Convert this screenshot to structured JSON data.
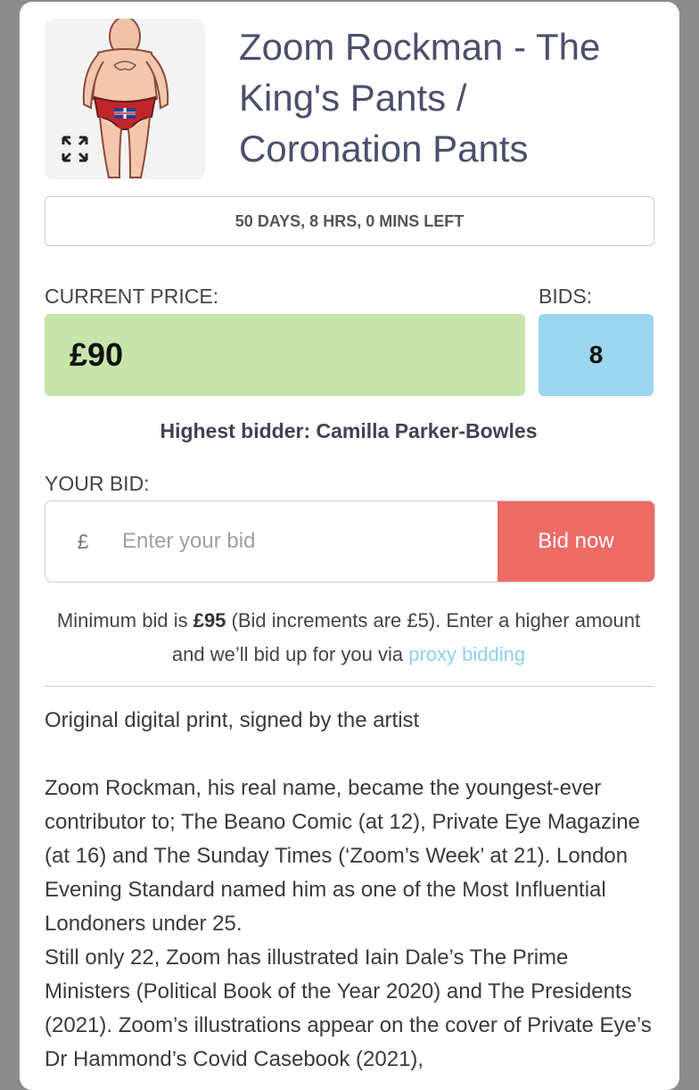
{
  "listing": {
    "title": "Zoom Rockman - The King's Pants / Coronation Pants",
    "time_left": "50 DAYS, 8 HRS, 0 MINS LEFT",
    "current_price_label": "CURRENT PRICE:",
    "current_price": "£90",
    "bids_label": "BIDS:",
    "bids_count": "8",
    "highest_bidder": "Highest bidder: Camilla Parker-Bowles"
  },
  "bid_form": {
    "label": "YOUR BID:",
    "currency_symbol": "£",
    "placeholder": "Enter your bid",
    "button_label": "Bid now",
    "min_prefix": "Minimum bid is ",
    "min_amount": "£95",
    "min_suffix": " (Bid increments are £5). Enter a higher amount and we’ll bid up for you via ",
    "proxy_link": "proxy bidding"
  },
  "description": {
    "line1": "Original digital print, signed by the artist",
    "para1": "Zoom Rockman, his real name, became the youngest-ever contributor to; The Beano Comic (at 12), Private Eye Magazine (at 16) and The Sunday Times (‘Zoom’s Week’ at 21). London Evening Standard named him as one of the Most Influential Londoners under 25.",
    "para2": "Still only 22, Zoom has illustrated Iain Dale’s The Prime Ministers (Political Book of the Year 2020) and The Presidents (2021). Zoom’s illustrations appear on the cover of Private Eye’s Dr Hammond’s Covid Casebook (2021),"
  },
  "colors": {
    "price_bg": "#c7e5ab",
    "bids_bg": "#9ad7ef",
    "bid_button": "#ee6b66",
    "link": "#8fd0ea"
  },
  "icons": [
    "expand-icon",
    "artwork-thumbnail"
  ]
}
